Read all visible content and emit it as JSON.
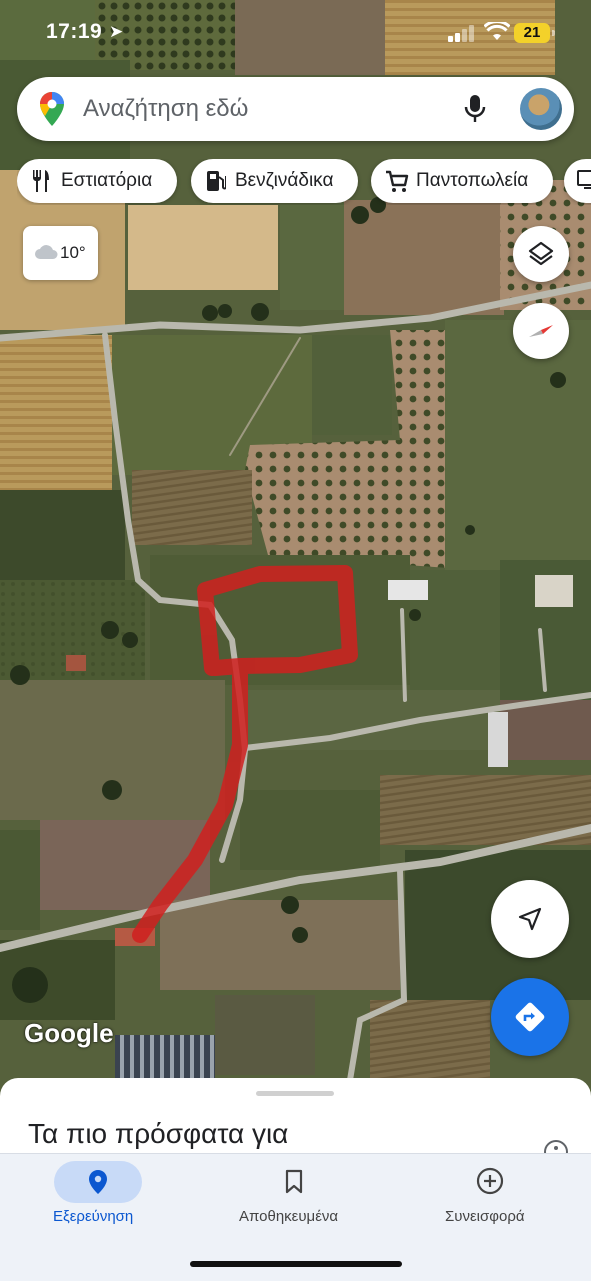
{
  "status": {
    "time": "17:19",
    "battery": "21"
  },
  "search": {
    "placeholder": "Αναζήτηση εδώ"
  },
  "chips": [
    {
      "label": "Εστιατόρια",
      "icon": "fork-knife-icon"
    },
    {
      "label": "Βενζινάδικα",
      "icon": "gas-station-icon"
    },
    {
      "label": "Παντοπωλεία",
      "icon": "cart-icon"
    }
  ],
  "weather": {
    "temp": "10°"
  },
  "map": {
    "logo": "Google"
  },
  "sheet": {
    "title": "Τα πιο πρόσφατα για"
  },
  "nav": [
    {
      "label": "Εξερεύνηση",
      "icon": "location-pin-icon",
      "active": true
    },
    {
      "label": "Αποθηκευμένα",
      "icon": "bookmark-icon",
      "active": false
    },
    {
      "label": "Συνεισφορά",
      "icon": "plus-circle-icon",
      "active": false
    }
  ],
  "colors": {
    "accent": "#1a73e8",
    "route_highlight": "#d0201f",
    "active_nav_bg": "#c8daf7"
  }
}
